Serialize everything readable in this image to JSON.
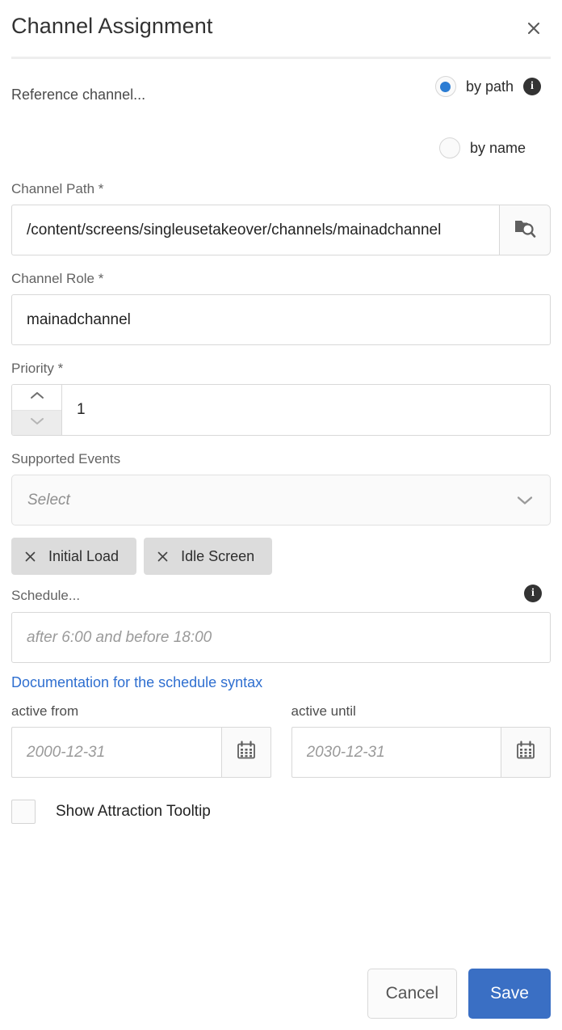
{
  "dialog": {
    "title": "Channel Assignment",
    "close_icon": "close-icon"
  },
  "reference_channel": {
    "label": "Reference channel...",
    "info_icon": "info-icon",
    "options": [
      {
        "label": "by path",
        "selected": true
      },
      {
        "label": "by name",
        "selected": false
      }
    ]
  },
  "channel_path": {
    "label": "Channel Path *",
    "value": "/content/screens/singleusetakeover/channels/mainadchannel",
    "placeholder": "",
    "browse_icon": "folder-search-icon"
  },
  "channel_role": {
    "label": "Channel Role *",
    "value": "mainadchannel",
    "placeholder": ""
  },
  "priority": {
    "label": "Priority *",
    "value": "1",
    "increment_icon": "chevron-up-icon",
    "decrement_icon": "chevron-down-icon"
  },
  "supported_events": {
    "label": "Supported Events",
    "placeholder": "Select",
    "chevron_icon": "chevron-down-icon",
    "chips": [
      {
        "label": "Initial Load",
        "remove_icon": "close-icon"
      },
      {
        "label": "Idle Screen",
        "remove_icon": "close-icon"
      }
    ]
  },
  "schedule": {
    "label": "Schedule...",
    "info_icon": "info-icon",
    "placeholder": "after 6:00 and before 18:00",
    "value": "",
    "doc_link": "Documentation for the schedule syntax"
  },
  "active_from": {
    "label": "active from",
    "placeholder": "2000-12-31",
    "value": "",
    "calendar_icon": "calendar-icon"
  },
  "active_until": {
    "label": "active until",
    "placeholder": "2030-12-31",
    "value": "",
    "calendar_icon": "calendar-icon"
  },
  "tooltip_option": {
    "label": "Show Attraction Tooltip",
    "checked": false
  },
  "footer": {
    "cancel_label": "Cancel",
    "save_label": "Save"
  },
  "colors": {
    "accent": "#3a6fc4",
    "radio_selected": "#2b7cd3",
    "link": "#2f6fd0",
    "chip_bg": "#dcdcdc",
    "info_bg": "#333333"
  }
}
